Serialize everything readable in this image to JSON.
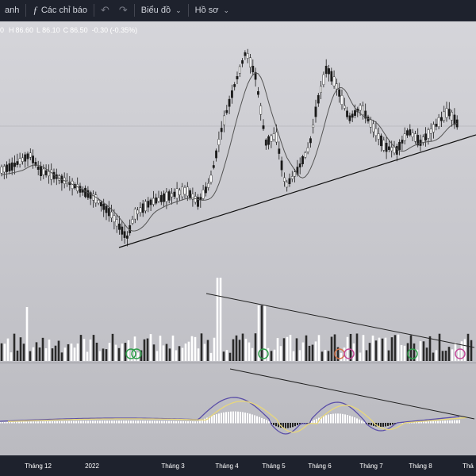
{
  "toolbar": {
    "left_fragment": "anh",
    "indicators_label": "Các chỉ báo",
    "chart_menu_label": "Biểu đồ",
    "profile_menu_label": "Hồ sơ"
  },
  "ohlc": {
    "o_fragment": "0",
    "h_key": "H",
    "h_val": "86.60",
    "l_key": "L",
    "l_val": "86.10",
    "c_key": "C",
    "c_val": "86.50",
    "change": "-0.30 (-0.35%)"
  },
  "x_axis_labels": [
    "Tháng 12",
    "2022",
    "Tháng 3",
    "Tháng 4",
    "Tháng 5",
    "Tháng 6",
    "Tháng 7",
    "Tháng 8",
    "Thá"
  ],
  "colors": {
    "background": "#1e222d",
    "chart_bg_top": "#d5d5da",
    "up_candle": "#ffffff",
    "down_candle": "#1a1a1a",
    "ma_line": "#555555",
    "trendline": "#111111",
    "macd_line": "#5b4fa8",
    "signal_line": "#e8d77a",
    "hist_pos": "#ffffff",
    "hist_neg": "#222222",
    "marker_green": "#2e9e4a",
    "marker_orange": "#d6754a",
    "marker_pink": "#c44a9a"
  },
  "icons": [
    "fx-icon",
    "undo-icon",
    "redo-icon",
    "chevron-down-icon"
  ]
}
